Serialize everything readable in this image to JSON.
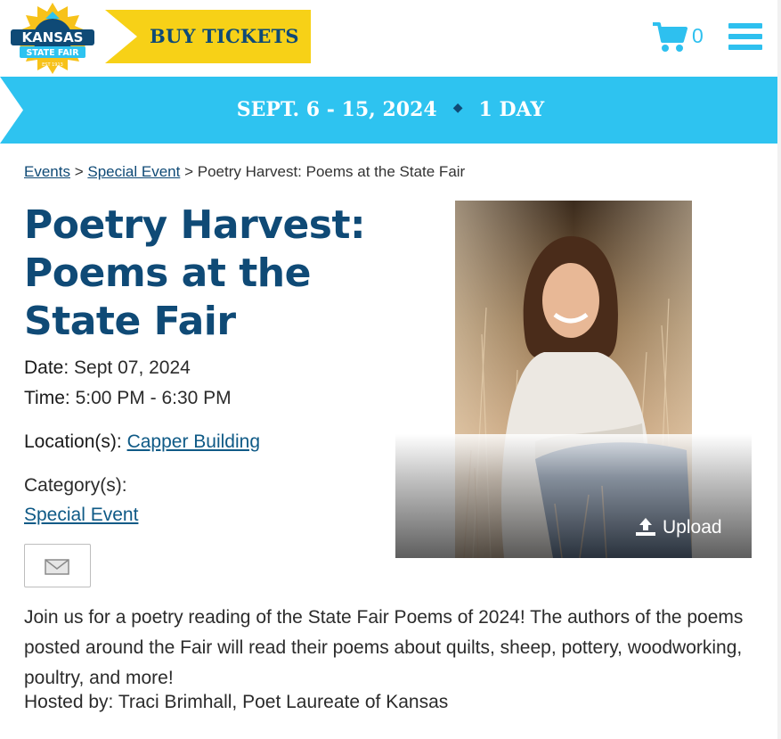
{
  "header": {
    "logo": {
      "line1": "KANSAS",
      "line2": "STATE FAIR",
      "est": "EST 1913"
    },
    "buy_tickets_label": "BUY TICKETS",
    "cart_count": "0",
    "cart_icon": "shopping-cart-icon",
    "menu_icon": "hamburger-menu-icon"
  },
  "banner": {
    "dates": "SEPT. 6 - 15, 2024",
    "separator": "◆",
    "duration": "1 DAY"
  },
  "breadcrumb": {
    "items": [
      "Events",
      "Special Event"
    ],
    "separator": ">",
    "current": "Poetry Harvest: Poems at the State Fair"
  },
  "event": {
    "title": "Poetry Harvest: Poems at the State Fair",
    "date_label": "Date:",
    "date_value": "Sept 07, 2024",
    "time_label": "Time:",
    "time_value": "5:00 PM - 6:30 PM",
    "location_label": "Location(s):",
    "location_value": "Capper Building",
    "category_label": "Category(s):",
    "category_value": "Special Event",
    "email_icon": "envelope-icon",
    "upload_label": "Upload",
    "upload_icon": "upload-icon",
    "description": "Join us for a poetry reading of the State Fair Poems of 2024! The authors of the poems posted around the Fair will read their poems about quilts, sheep, pottery, woodworking, poultry, and more!",
    "hosted_by": "Hosted by: Traci Brimhall, Poet Laureate of Kansas"
  },
  "colors": {
    "navy": "#0f4a76",
    "sky": "#2ec3f0",
    "gold": "#f7d117",
    "link": "#0f5a86"
  }
}
